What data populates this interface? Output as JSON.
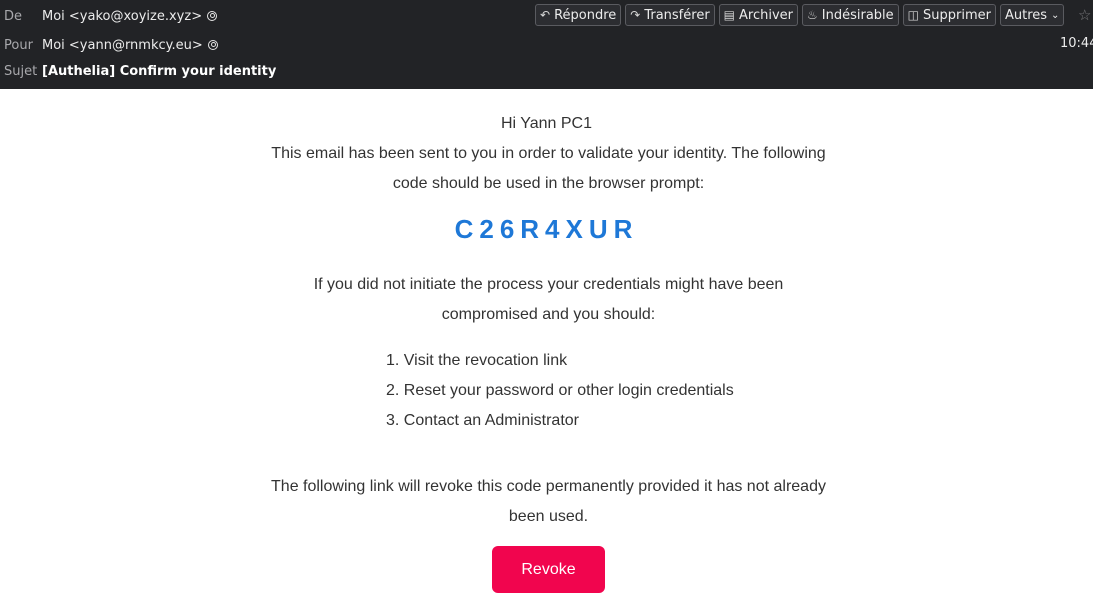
{
  "header": {
    "from_label": "De",
    "from_value": "Moi <yako@xoyize.xyz>",
    "to_label": "Pour",
    "to_value": "Moi <yann@rnmkcy.eu>",
    "subject_label": "Sujet",
    "subject_value": "[Authelia] Confirm your identity",
    "time": "10:44",
    "toolbar": {
      "reply": "Répondre",
      "forward": "Transférer",
      "archive": "Archiver",
      "junk": "Indésirable",
      "delete": "Supprimer",
      "more": "Autres"
    }
  },
  "email": {
    "greeting": "Hi Yann PC1",
    "intro": "This email has been sent to you in order to validate your identity. The following code should be used in the browser prompt:",
    "code": "C26R4XUR",
    "warning": "If you did not initiate the process your credentials might have been compromised and you should:",
    "steps": [
      "1. Visit the revocation link",
      "2. Reset your password or other login credentials",
      "3. Contact an Administrator"
    ],
    "revoke_note": "The following link will revoke this code permanently provided it has not already been used.",
    "revoke_button": "Revoke"
  },
  "colors": {
    "header_bg": "#222326",
    "code": "#1e78d7",
    "revoke_button": "#f1054e"
  },
  "icons": [
    "reply-icon",
    "forward-icon",
    "archive-icon",
    "junk-icon",
    "trash-icon",
    "chevron-down-icon",
    "star-icon",
    "contact-icon"
  ]
}
